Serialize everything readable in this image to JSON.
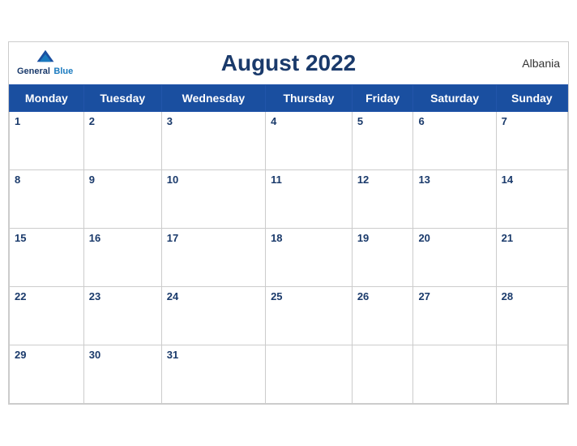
{
  "header": {
    "title": "August 2022",
    "country": "Albania",
    "logo": {
      "line1": "General",
      "line2": "Blue"
    }
  },
  "weekdays": [
    "Monday",
    "Tuesday",
    "Wednesday",
    "Thursday",
    "Friday",
    "Saturday",
    "Sunday"
  ],
  "weeks": [
    [
      1,
      2,
      3,
      4,
      5,
      6,
      7
    ],
    [
      8,
      9,
      10,
      11,
      12,
      13,
      14
    ],
    [
      15,
      16,
      17,
      18,
      19,
      20,
      21
    ],
    [
      22,
      23,
      24,
      25,
      26,
      27,
      28
    ],
    [
      29,
      30,
      31,
      null,
      null,
      null,
      null
    ]
  ],
  "accent_color": "#1a4fa0"
}
